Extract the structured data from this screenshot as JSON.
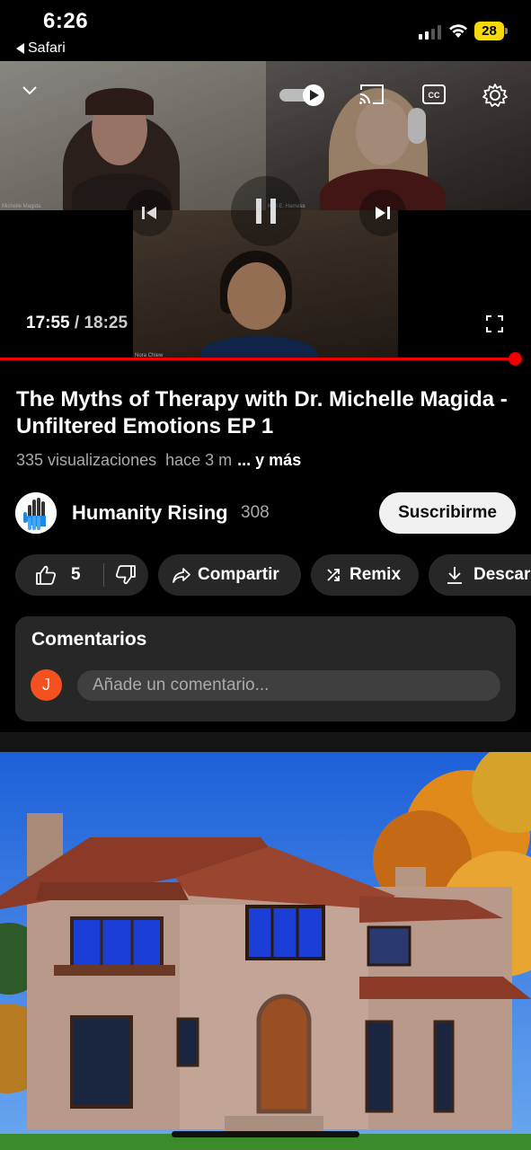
{
  "status_bar": {
    "time": "6:26",
    "back_app": "Safari",
    "battery": "28",
    "battery_color": "#f5d90a"
  },
  "player": {
    "current_time": "17:55",
    "separator": " / ",
    "duration": "18:25",
    "progress_fraction": 0.97,
    "progress_color": "#ee0000",
    "participants": [
      "Michelle Magida",
      "Kori E. Hamess",
      "Nora Chiew"
    ],
    "icons": [
      "chevron-down-icon",
      "autoplay-toggle-icon",
      "cast-icon",
      "captions-icon",
      "settings-icon",
      "previous-icon",
      "pause-icon",
      "next-icon",
      "fullscreen-icon"
    ]
  },
  "video": {
    "title": "The Myths of Therapy with Dr. Michelle Magida - Unfiltered Emotions EP 1",
    "views": "335 visualizaciones",
    "age": "hace 3 m",
    "more": "... y más"
  },
  "channel": {
    "name": "Humanity Rising",
    "subscribers": "308",
    "subscribe_label": "Suscribirme"
  },
  "actions": {
    "likes": "5",
    "share": "Compartir",
    "remix": "Remix",
    "download": "Descar"
  },
  "comments": {
    "title": "Comentarios",
    "avatar_initial": "J",
    "placeholder": "Añade un comentario..."
  }
}
